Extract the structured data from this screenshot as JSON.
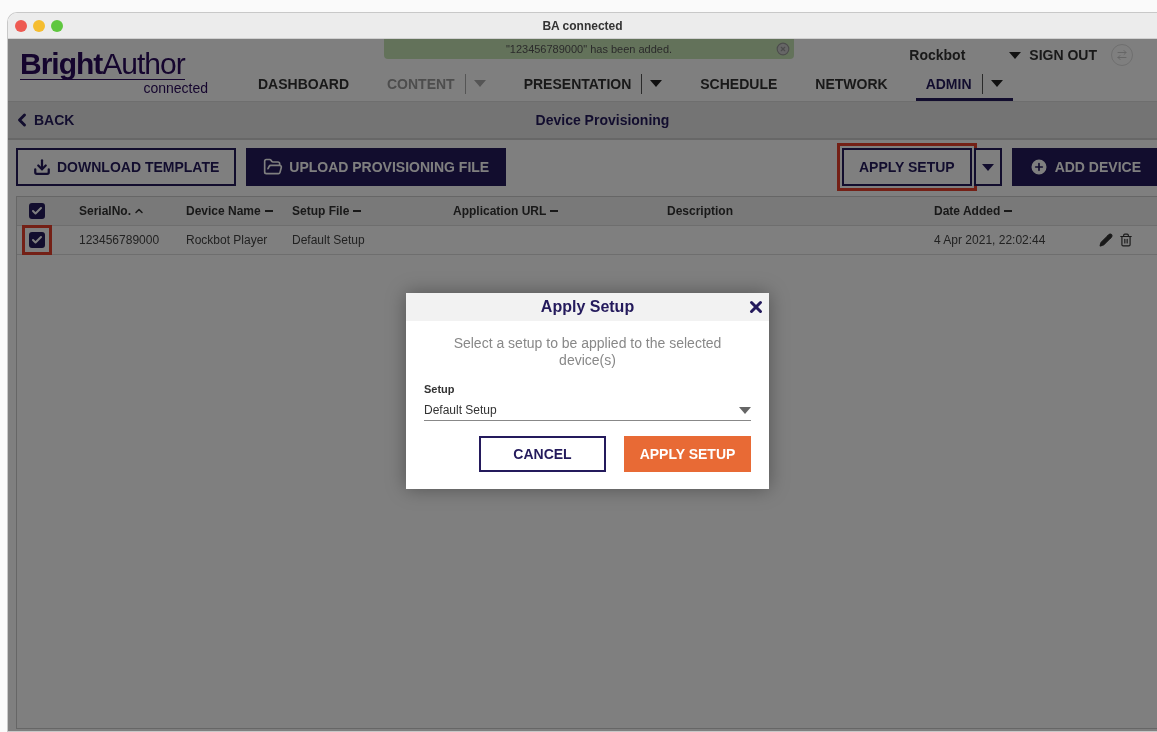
{
  "window": {
    "title": "BA connected"
  },
  "toast": {
    "message": "\"123456789000\" has been added."
  },
  "logo": {
    "name": "**Bright**Author",
    "subtitle": "connected"
  },
  "user": {
    "name": "Rockbot",
    "sign_out": "SIGN OUT"
  },
  "nav": [
    {
      "label": "DASHBOARD",
      "selected": false,
      "disabled": false,
      "menu": false
    },
    {
      "label": "CONTENT",
      "selected": false,
      "disabled": true,
      "menu": true
    },
    {
      "label": "PRESENTATION",
      "selected": false,
      "disabled": false,
      "menu": true
    },
    {
      "label": "SCHEDULE",
      "selected": false,
      "disabled": false,
      "menu": false
    },
    {
      "label": "NETWORK",
      "selected": false,
      "disabled": false,
      "menu": false
    },
    {
      "label": "ADMIN",
      "selected": true,
      "disabled": false,
      "menu": true
    }
  ],
  "subheader": {
    "back": "BACK",
    "title": "Device Provisioning"
  },
  "toolbar": {
    "download": "DOWNLOAD TEMPLATE",
    "upload": "UPLOAD PROVISIONING FILE",
    "apply": "APPLY SETUP",
    "apply_highlighted": true,
    "add": "ADD DEVICE"
  },
  "table": {
    "all_checked": true,
    "columns": [
      {
        "label": "SerialNo.",
        "kind": "ascending"
      },
      {
        "label": "Device Name",
        "kind": "sortable"
      },
      {
        "label": "Setup File",
        "kind": "sortable"
      },
      {
        "label": "Application URL",
        "kind": "sortable"
      },
      {
        "label": "Description",
        "kind": "plain"
      },
      {
        "label": "Date Added",
        "kind": "sortable"
      }
    ],
    "rows": [
      {
        "checked": true,
        "highlighted": true,
        "cells": [
          "123456789000",
          "Rockbot Player",
          "Default Setup",
          "",
          "",
          "4 Apr 2021, 22:02:44"
        ]
      }
    ]
  },
  "dialog": {
    "title": "Apply Setup",
    "message": "Select a setup to be applied to the selected device(s)",
    "field_label": "Setup",
    "field_value": "Default Setup",
    "cancel": "CANCEL",
    "confirm": "APPLY SETUP"
  }
}
